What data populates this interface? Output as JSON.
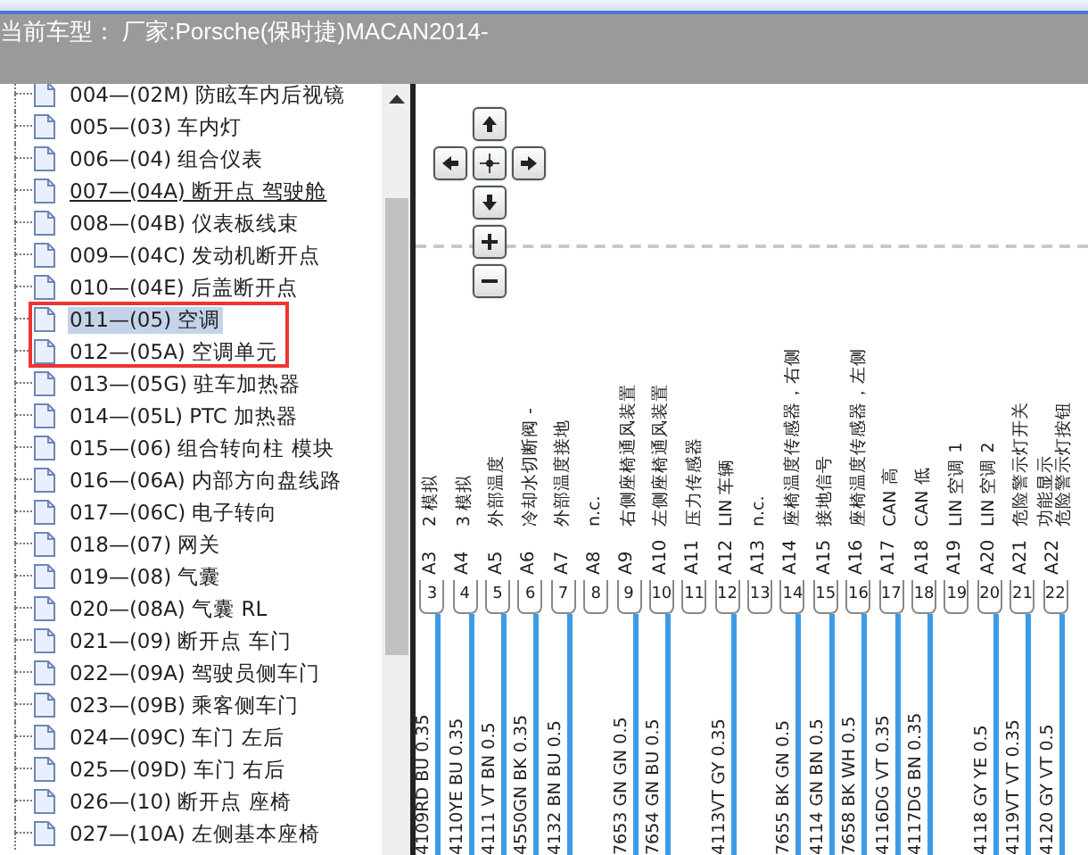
{
  "header": {
    "title": "当前车型： 厂家:Porsche(保时捷)MACAN2014-"
  },
  "tree": {
    "items": [
      {
        "text": "004—(02M) 防眩车内后视镜",
        "selected": false,
        "hovered": false,
        "marked": false
      },
      {
        "text": "005—(03) 车内灯",
        "selected": false,
        "hovered": false,
        "marked": false
      },
      {
        "text": "006—(04) 组合仪表",
        "selected": false,
        "hovered": false,
        "marked": false
      },
      {
        "text": "007—(04A) 断开点 驾驶舱",
        "selected": false,
        "hovered": true,
        "marked": false
      },
      {
        "text": "008—(04B) 仪表板线束",
        "selected": false,
        "hovered": false,
        "marked": false
      },
      {
        "text": "009—(04C) 发动机断开点",
        "selected": false,
        "hovered": false,
        "marked": false
      },
      {
        "text": "010—(04E) 后盖断开点",
        "selected": false,
        "hovered": false,
        "marked": false
      },
      {
        "text": "011—(05) 空调",
        "selected": true,
        "hovered": false,
        "marked": true
      },
      {
        "text": "012—(05A) 空调单元",
        "selected": false,
        "hovered": false,
        "marked": true
      },
      {
        "text": "013—(05G) 驻车加热器",
        "selected": false,
        "hovered": false,
        "marked": false
      },
      {
        "text": "014—(05L) PTC 加热器",
        "selected": false,
        "hovered": false,
        "marked": false
      },
      {
        "text": "015—(06) 组合转向柱 模块",
        "selected": false,
        "hovered": false,
        "marked": false
      },
      {
        "text": "016—(06A) 内部方向盘线路",
        "selected": false,
        "hovered": false,
        "marked": false
      },
      {
        "text": "017—(06C) 电子转向",
        "selected": false,
        "hovered": false,
        "marked": false
      },
      {
        "text": "018—(07) 网关",
        "selected": false,
        "hovered": false,
        "marked": false
      },
      {
        "text": "019—(08) 气囊",
        "selected": false,
        "hovered": false,
        "marked": false
      },
      {
        "text": "020—(08A) 气囊 RL",
        "selected": false,
        "hovered": false,
        "marked": false
      },
      {
        "text": "021—(09) 断开点 车门",
        "selected": false,
        "hovered": false,
        "marked": false
      },
      {
        "text": "022—(09A) 驾驶员侧车门",
        "selected": false,
        "hovered": false,
        "marked": false
      },
      {
        "text": "023—(09B) 乘客侧车门",
        "selected": false,
        "hovered": false,
        "marked": false
      },
      {
        "text": "024—(09C) 车门 左后",
        "selected": false,
        "hovered": false,
        "marked": false
      },
      {
        "text": "025—(09D) 车门 右后",
        "selected": false,
        "hovered": false,
        "marked": false
      },
      {
        "text": "026—(10) 断开点 座椅",
        "selected": false,
        "hovered": false,
        "marked": false
      },
      {
        "text": "027—(10A) 左侧基本座椅",
        "selected": false,
        "hovered": false,
        "marked": false
      }
    ]
  },
  "diagram": {
    "nav_buttons": [
      {
        "kind": "up"
      },
      {
        "kind": "left"
      },
      {
        "kind": "center"
      },
      {
        "kind": "right"
      },
      {
        "kind": "down"
      },
      {
        "kind": "zoom_in"
      },
      {
        "kind": "zoom_out"
      }
    ],
    "pins": [
      {
        "label": "A3",
        "desc": [
          "2 模拟"
        ],
        "number": "3",
        "wire": "4109RD BU 0.35"
      },
      {
        "label": "A4",
        "desc": [
          "3 模拟"
        ],
        "number": "4",
        "wire": "4110YE BU 0.35"
      },
      {
        "label": "A5",
        "desc": [
          "外部温度"
        ],
        "number": "5",
        "wire": "4111 VT BN 0.5"
      },
      {
        "label": "A6",
        "desc": [
          "冷却水切断阀 -"
        ],
        "number": "6",
        "wire": "4550GN BK 0.35"
      },
      {
        "label": "A7",
        "desc": [
          "外部温度接地"
        ],
        "number": "7",
        "wire": "4132 BN BU 0.5"
      },
      {
        "label": "A8",
        "desc": [
          "n.c."
        ],
        "number": "8"
      },
      {
        "label": "A9",
        "desc": [
          "右侧座椅通风装置"
        ],
        "number": "9",
        "wire": "7653 GN GN 0.5"
      },
      {
        "label": "A10",
        "desc": [
          "左侧座椅通风装置"
        ],
        "number": "10",
        "wire": "7654 GN BU 0.5"
      },
      {
        "label": "A11",
        "desc": [
          "压力传感器"
        ],
        "number": "11"
      },
      {
        "label": "A12",
        "desc": [
          "LIN 车辆"
        ],
        "number": "12",
        "wire": "4113VT GY 0.35"
      },
      {
        "label": "A13",
        "desc": [
          "n.c."
        ],
        "number": "13"
      },
      {
        "label": "A14",
        "desc": [
          "座椅温度传感器，右侧"
        ],
        "number": "14",
        "wire": "7655 BK GN 0.5"
      },
      {
        "label": "A15",
        "desc": [
          "接地信号"
        ],
        "number": "15",
        "wire": "4114 GN BN 0.5"
      },
      {
        "label": "A16",
        "desc": [
          "座椅温度传感器，左侧"
        ],
        "number": "16",
        "wire": "7658 BK WH 0.5"
      },
      {
        "label": "A17",
        "desc": [
          "CAN 高"
        ],
        "number": "17",
        "wire": "4116DG VT 0.35"
      },
      {
        "label": "A18",
        "desc": [
          "CAN 低"
        ],
        "number": "18",
        "wire": "4117DG BN 0.35"
      },
      {
        "label": "A19",
        "desc": [
          "LIN 空调 1"
        ],
        "number": "19"
      },
      {
        "label": "A20",
        "desc": [
          "LIN 空调 2"
        ],
        "number": "20",
        "wire": "4118 GY YE 0.5"
      },
      {
        "label": "A21",
        "desc": [
          "危险警示灯开关"
        ],
        "number": "21",
        "wire": "4119VT VT 0.35"
      },
      {
        "label": "A22",
        "desc": [
          "功能显示",
          "危险警示灯按钮"
        ],
        "number": "22",
        "wire": "4120 GY VT 0.5"
      }
    ]
  }
}
